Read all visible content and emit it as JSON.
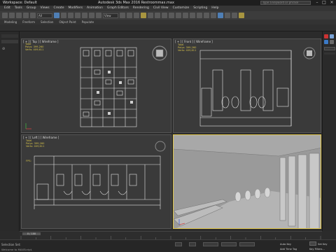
{
  "title_bar": {
    "workspace": "Workspace: Default",
    "title": "Autodesk 3ds Max 2016    Restroommax.max",
    "search_placeholder": "Type a keyword or phrase"
  },
  "menus": [
    "Edit",
    "Tools",
    "Group",
    "Views",
    "Create",
    "Modifiers",
    "Animation",
    "Graph Editors",
    "Rendering",
    "Civil View",
    "Customize",
    "Scripting",
    "Help"
  ],
  "toolbar": {
    "selection_filter": "All",
    "view_dropdown": "View"
  },
  "ribbon_tabs": [
    "Modeling",
    "Freeform",
    "Selection",
    "Object Paint",
    "Populate"
  ],
  "viewports": [
    {
      "id": "top",
      "label": "[ + ] [ Top ] [ Wireframe ]"
    },
    {
      "id": "front",
      "label": "[ + ] [ Front ] [ Wireframe ]",
      "stats": "Total\nPolys: 399,260\nVerts: 409,611"
    },
    {
      "id": "left",
      "label": "[ + ] [ Left ] [ Wireframe ]",
      "stats": "Total\nPolys: 399,260\nVerts: 409,611",
      "fps": "FPS:"
    },
    {
      "id": "perspective",
      "label": ""
    }
  ],
  "top_viewport_stats": "Total\nPolys: 399,260\nVerts: 409,611",
  "timeline": {
    "frame_display": "0 / 100"
  },
  "status": {
    "selection": "Selection Set:",
    "prompt": "Welcome to MAXScript.",
    "auto_key": "Auto Key",
    "set_key": "Set Key",
    "key_filters": "Key Filters...",
    "add_time_tag": "Add Time Tag"
  },
  "colors": {
    "active_border": "#e0c64a",
    "viewport_bg": "#3a3a3a",
    "stats_text": "#d4c04a"
  }
}
